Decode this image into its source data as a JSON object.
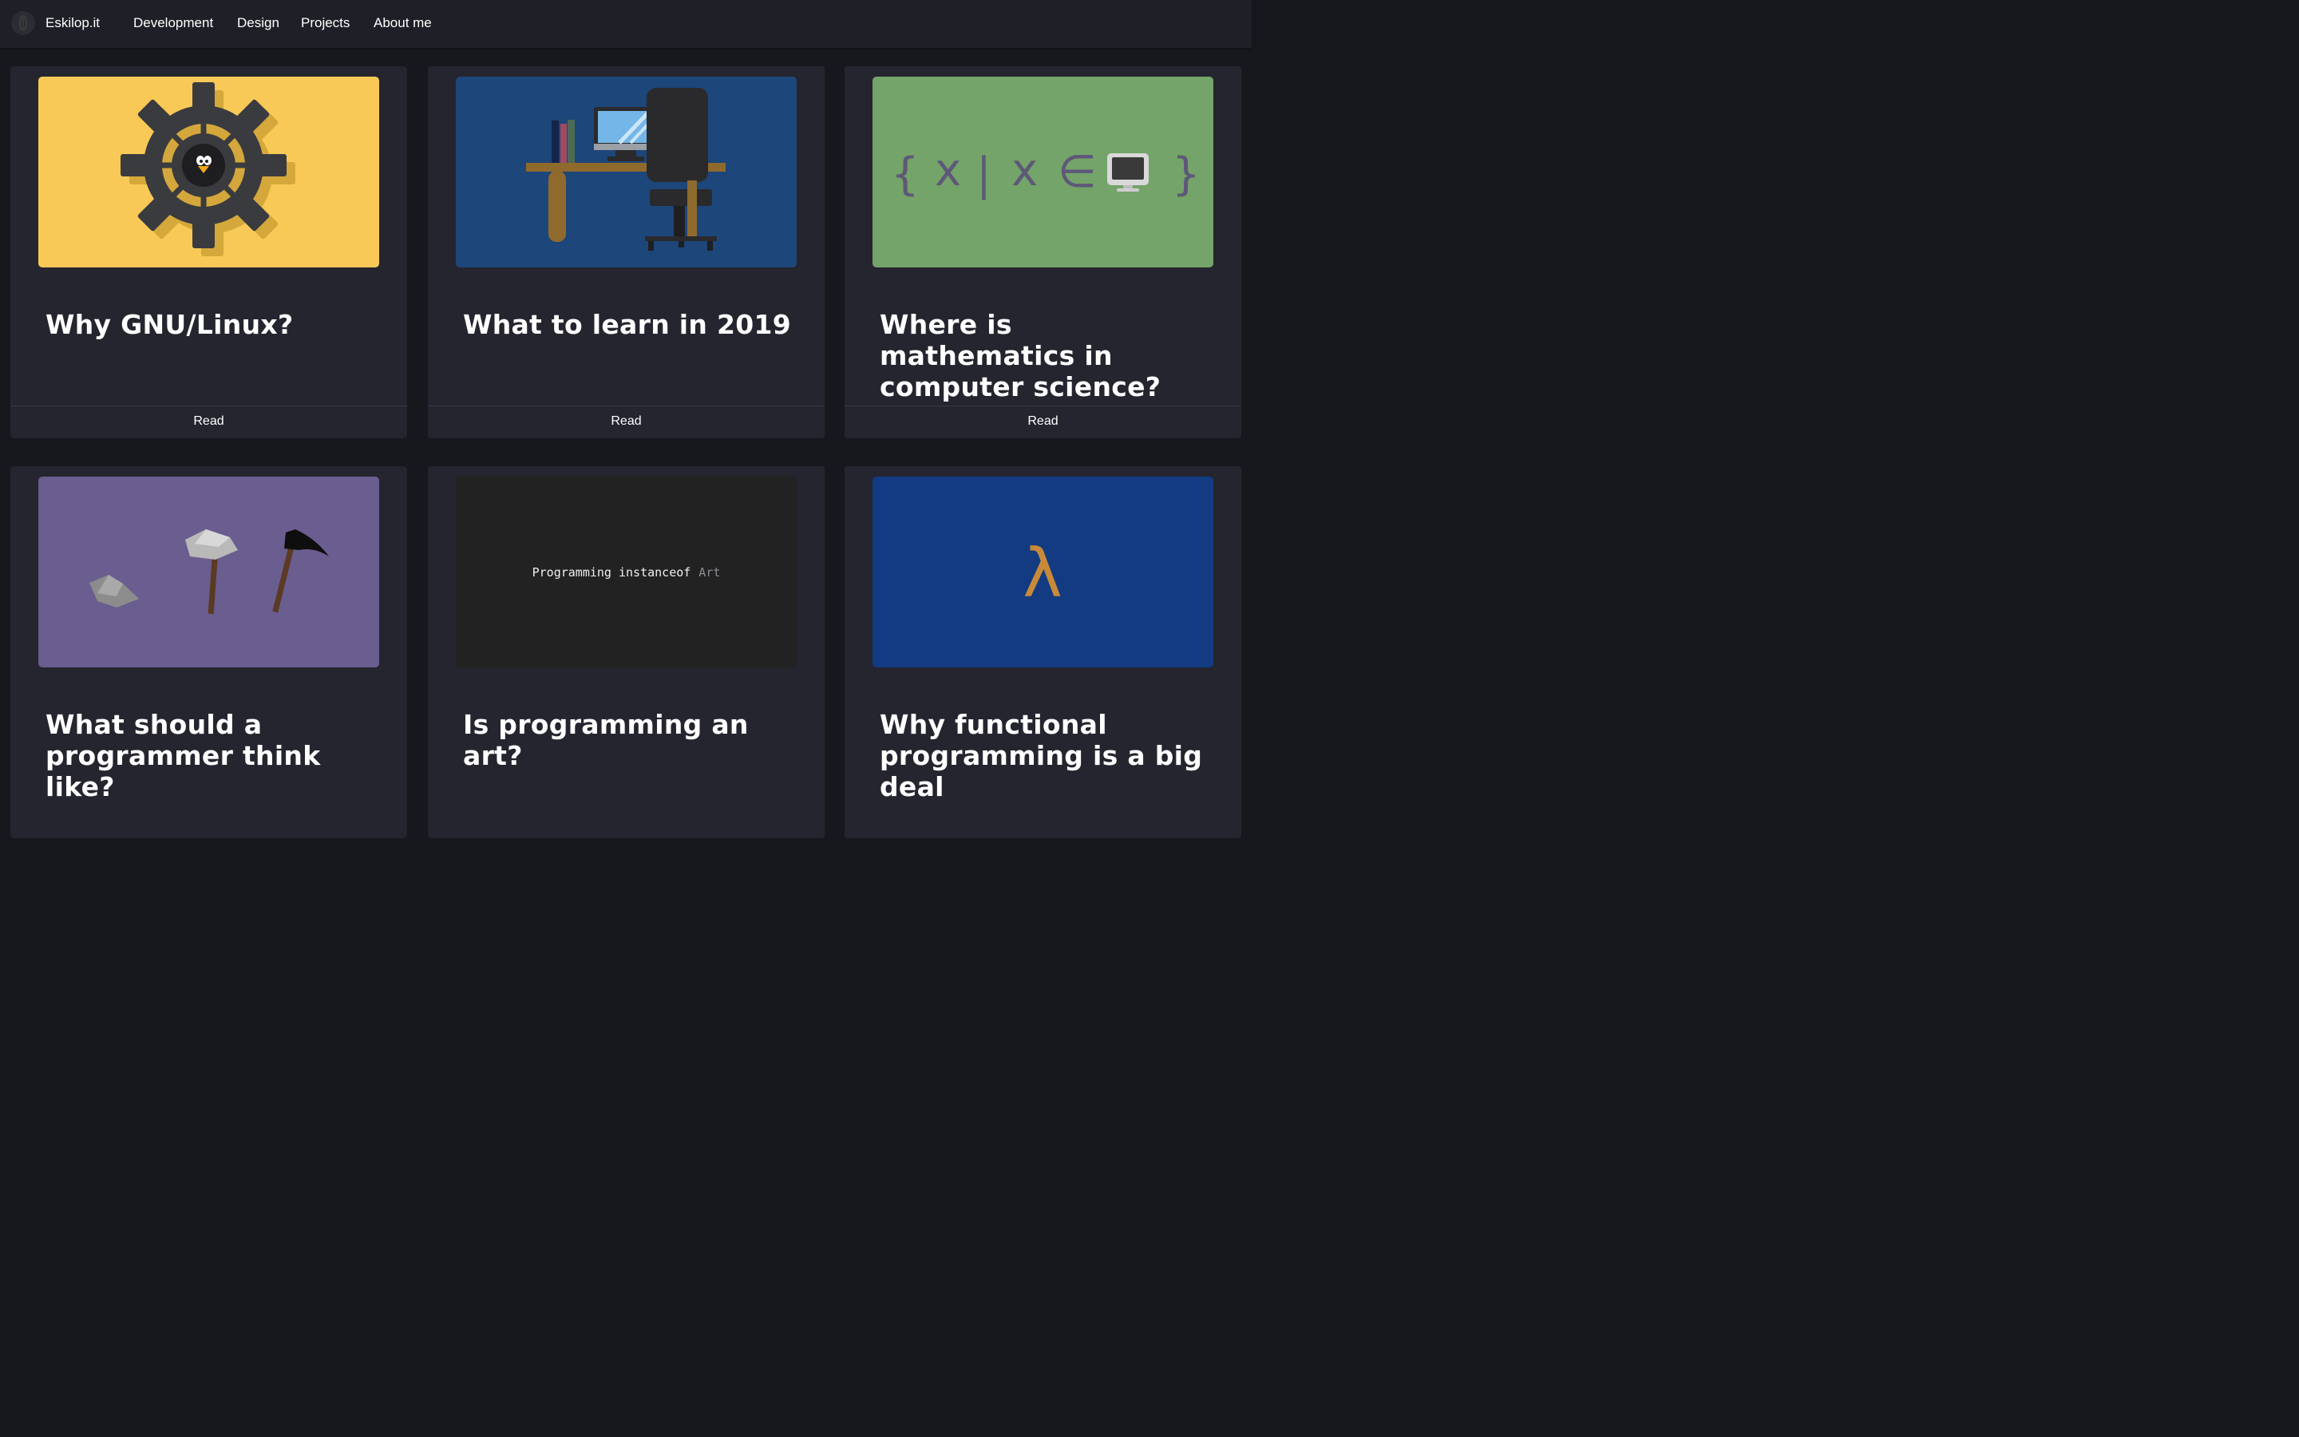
{
  "navbar": {
    "brand": "Eskilop.it",
    "links": [
      "Development",
      "Design",
      "Projects",
      "About me"
    ]
  },
  "cards": [
    {
      "title": "Why GNU/Linux?",
      "action": "Read",
      "thumb_bg": "#f8c956",
      "thumb_icon": "gear-tux-icon"
    },
    {
      "title": "What to learn in 2019",
      "action": "Read",
      "thumb_bg": "#1d467a",
      "thumb_icon": "desk-chair-icon"
    },
    {
      "title": "Where is mathematics in computer science?",
      "action": "Read",
      "thumb_bg": "#74a469",
      "thumb_icon": "set-notation-icon",
      "formula": {
        "open": "{",
        "x1": "x",
        "bar": "|",
        "x2": "x",
        "elem": "∈",
        "close": "}"
      }
    },
    {
      "title": "What should a programmer think like?",
      "thumb_bg": "#6a5d8f",
      "thumb_icon": "stone-tools-icon"
    },
    {
      "title": "Is programming an art?",
      "thumb_bg": "#222222",
      "thumb_icon": "code-text-icon",
      "code": {
        "main": "Programming instanceof",
        "accent": "Art"
      }
    },
    {
      "title": "Why functional programming is a big deal",
      "thumb_bg": "#123b82",
      "thumb_icon": "lambda-icon",
      "symbol": "λ"
    }
  ],
  "colors": {
    "page_bg": "#17181d",
    "navbar_bg": "#1f2027",
    "card_bg": "#24252e",
    "lambda": "#c88a3a",
    "formula": "#5e5878"
  }
}
